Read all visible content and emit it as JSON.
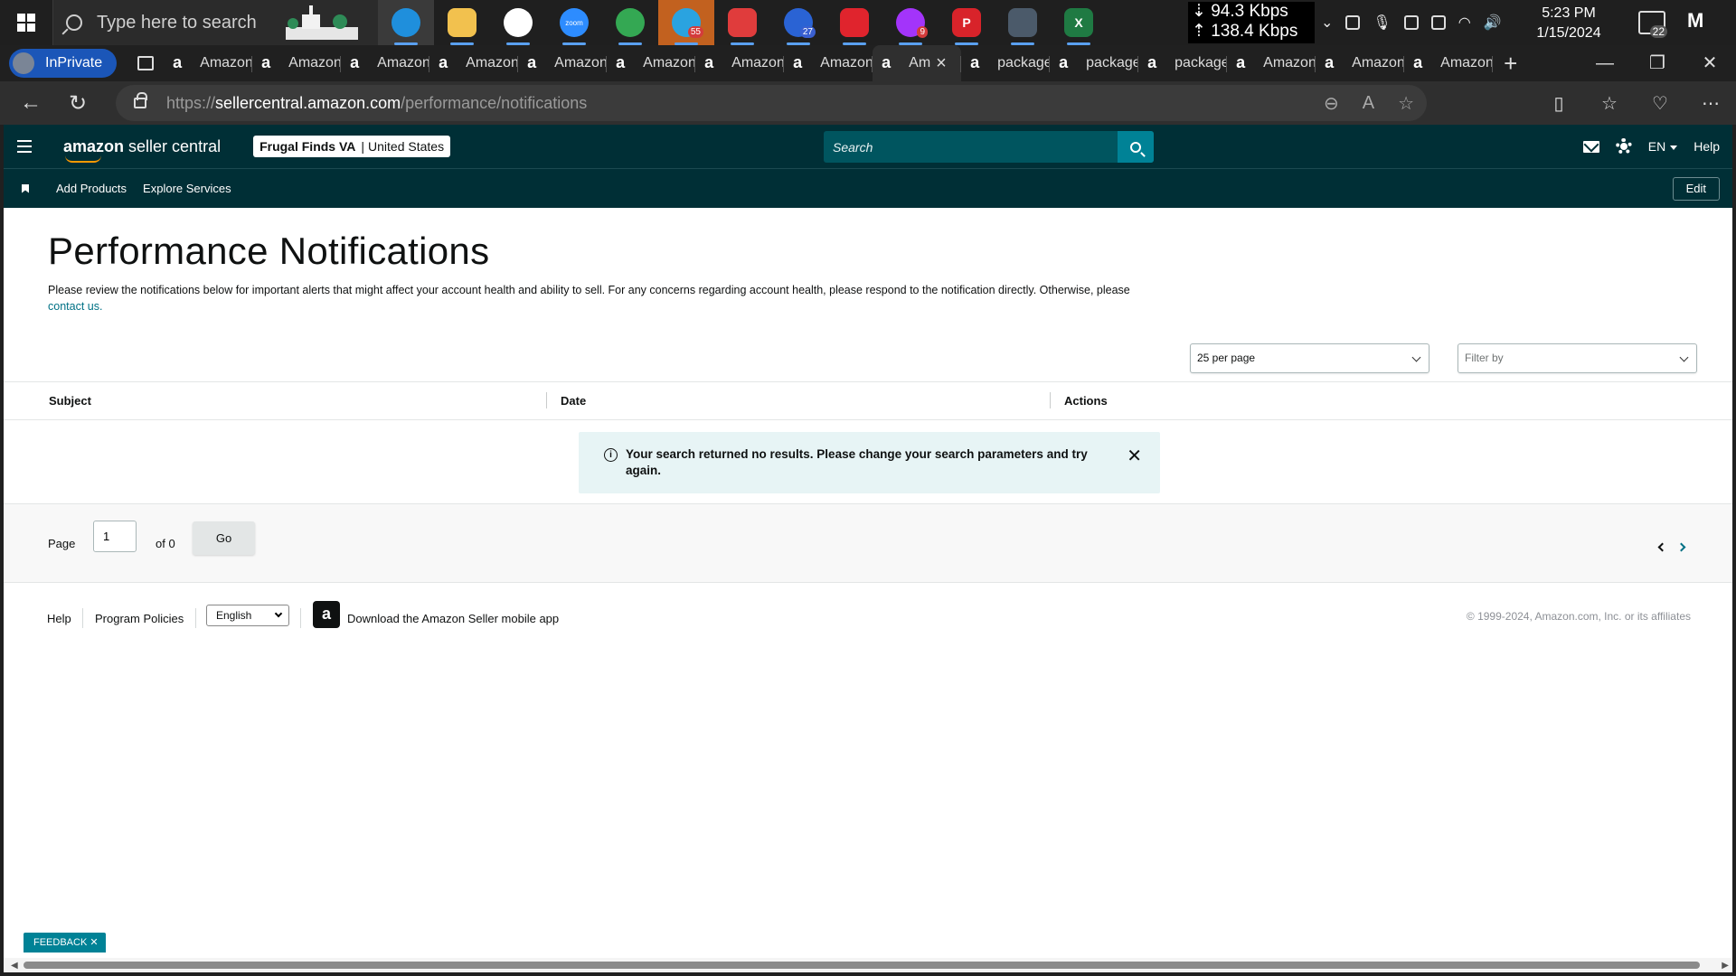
{
  "taskbar": {
    "search_placeholder": "Type here to search",
    "apps": [
      {
        "name": "edge",
        "label": "",
        "color": "#1f8fdc",
        "badge": ""
      },
      {
        "name": "file-explorer",
        "label": "",
        "color": "#f2c14e",
        "badge": ""
      },
      {
        "name": "slack",
        "label": "",
        "color": "#ffffff",
        "badge": ""
      },
      {
        "name": "zoom",
        "label": "zoom",
        "color": "#2d8cff",
        "badge": ""
      },
      {
        "name": "chrome",
        "label": "",
        "color": "#34a853",
        "badge": ""
      },
      {
        "name": "telegram",
        "label": "",
        "color": "#2aa3e0",
        "badge": "55"
      },
      {
        "name": "app-red",
        "label": "",
        "color": "#e03c3c",
        "badge": ""
      },
      {
        "name": "app-blue",
        "label": "",
        "color": "#2a63d4",
        "badge": "27"
      },
      {
        "name": "app-play",
        "label": "",
        "color": "#e0242d",
        "badge": ""
      },
      {
        "name": "messenger",
        "label": "",
        "color": "#a334fa",
        "badge": "9"
      },
      {
        "name": "app-p",
        "label": "P",
        "color": "#d8232a",
        "badge": ""
      },
      {
        "name": "calculator",
        "label": "",
        "color": "#4b5a6a",
        "badge": ""
      },
      {
        "name": "excel",
        "label": "X",
        "color": "#1f7a43",
        "badge": ""
      }
    ],
    "net_down": "⇣ 94.3 Kbps",
    "net_up": "⇡ 138.4 Kbps",
    "time": "5:23 PM",
    "date": "1/15/2024",
    "notification_count": "22"
  },
  "browser": {
    "inprivate_label": "InPrivate",
    "tabs": [
      {
        "label": "Amazon",
        "active": false,
        "favicon": "a"
      },
      {
        "label": "Amazon",
        "active": false,
        "favicon": "a"
      },
      {
        "label": "Amazon",
        "active": false,
        "favicon": "a"
      },
      {
        "label": "Amazon",
        "active": false,
        "favicon": "a"
      },
      {
        "label": "Amazon",
        "active": false,
        "favicon": "a"
      },
      {
        "label": "Amazon",
        "active": false,
        "favicon": "a"
      },
      {
        "label": "Amazon",
        "active": false,
        "favicon": "a"
      },
      {
        "label": "Amazon",
        "active": false,
        "favicon": "a"
      },
      {
        "label": "Am",
        "active": true,
        "favicon": "a"
      },
      {
        "label": "package",
        "active": false,
        "favicon": "a"
      },
      {
        "label": "package",
        "active": false,
        "favicon": "a"
      },
      {
        "label": "package",
        "active": false,
        "favicon": "a"
      },
      {
        "label": "Amazon",
        "active": false,
        "favicon": "a"
      },
      {
        "label": "Amazon",
        "active": false,
        "favicon": "a"
      },
      {
        "label": "Amazon",
        "active": false,
        "favicon": "a"
      }
    ],
    "url_scheme": "https://",
    "url_domain": "sellercentral.amazon.com",
    "url_path": "/performance/notifications"
  },
  "header": {
    "logo_bold": "amazon",
    "logo_rest": " seller central",
    "account_name": "Frugal Finds VA",
    "account_sep": "|",
    "account_region": "United States",
    "search_placeholder": "Search",
    "language": "EN",
    "help": "Help"
  },
  "subnav": {
    "links": [
      "Add Products",
      "Explore Services"
    ],
    "edit": "Edit"
  },
  "main": {
    "title": "Performance Notifications",
    "description": "Please review the notifications below for important alerts that might affect your account health and ability to sell. For any concerns regarding account health, please respond to the notification directly. Otherwise, please ",
    "contact_link": "contact us.",
    "per_page": "25 per page",
    "filter_placeholder": "Filter by",
    "columns": [
      "Subject",
      "Date",
      "Actions"
    ],
    "alert_message": "Your search returned no results. Please change your search parameters and try again.",
    "pager": {
      "page_label": "Page",
      "current_page": "1",
      "of_label": "of 0",
      "go": "Go"
    }
  },
  "footer": {
    "help": "Help",
    "policies": "Program Policies",
    "language": "English",
    "app_text": "Download the Amazon Seller mobile app",
    "copyright": "© 1999-2024, Amazon.com, Inc. or its affiliates"
  },
  "feedback": "FEEDBACK",
  "colors": {
    "header_bg": "#002f36",
    "search_btn": "#008296",
    "alert_bg": "#e7f4f5",
    "link": "#007185"
  }
}
